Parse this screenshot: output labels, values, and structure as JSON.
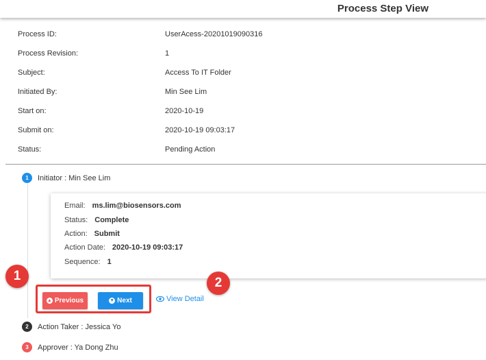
{
  "header": {
    "title": "Process Step View"
  },
  "info": [
    {
      "label": "Process ID:",
      "value": "UserAcess-20201019090316"
    },
    {
      "label": "Process Revision:",
      "value": "1"
    },
    {
      "label": "Subject:",
      "value": "Access To IT Folder"
    },
    {
      "label": "Initiated By:",
      "value": "Min See Lim"
    },
    {
      "label": "Start on:",
      "value": "2020-10-19"
    },
    {
      "label": "Submit on:",
      "value": "2020-10-19 09:03:17"
    },
    {
      "label": "Status:",
      "value": "Pending Action"
    }
  ],
  "steps": [
    {
      "number": "1",
      "text": "Initiator : Min See Lim",
      "color": "#1e8fe8"
    },
    {
      "number": "2",
      "text": "Action Taker : Jessica Yo",
      "color": "#333333"
    },
    {
      "number": "3",
      "text": "Approver : Ya Dong Zhu",
      "color": "#ef5a5a"
    }
  ],
  "detail": [
    {
      "label": "Email:",
      "value": "ms.lim@biosensors.com"
    },
    {
      "label": "Status:",
      "value": "Complete"
    },
    {
      "label": "Action:",
      "value": "Submit"
    },
    {
      "label": "Action Date:",
      "value": "2020-10-19 09:03:17"
    },
    {
      "label": "Sequence:",
      "value": "1"
    }
  ],
  "buttons": {
    "previous_label": "Previous",
    "previous_icon": "arrow-circle-up-icon",
    "next_label": "Next",
    "next_icon": "arrow-circle-down-icon",
    "view_detail_label": "View Detail",
    "view_detail_icon": "eye-icon"
  },
  "annotations": {
    "marker_1": "1",
    "marker_2": "2"
  },
  "colors": {
    "primary": "#1e8fe8",
    "danger": "#ef5a5a",
    "annotation": "#e53935"
  }
}
